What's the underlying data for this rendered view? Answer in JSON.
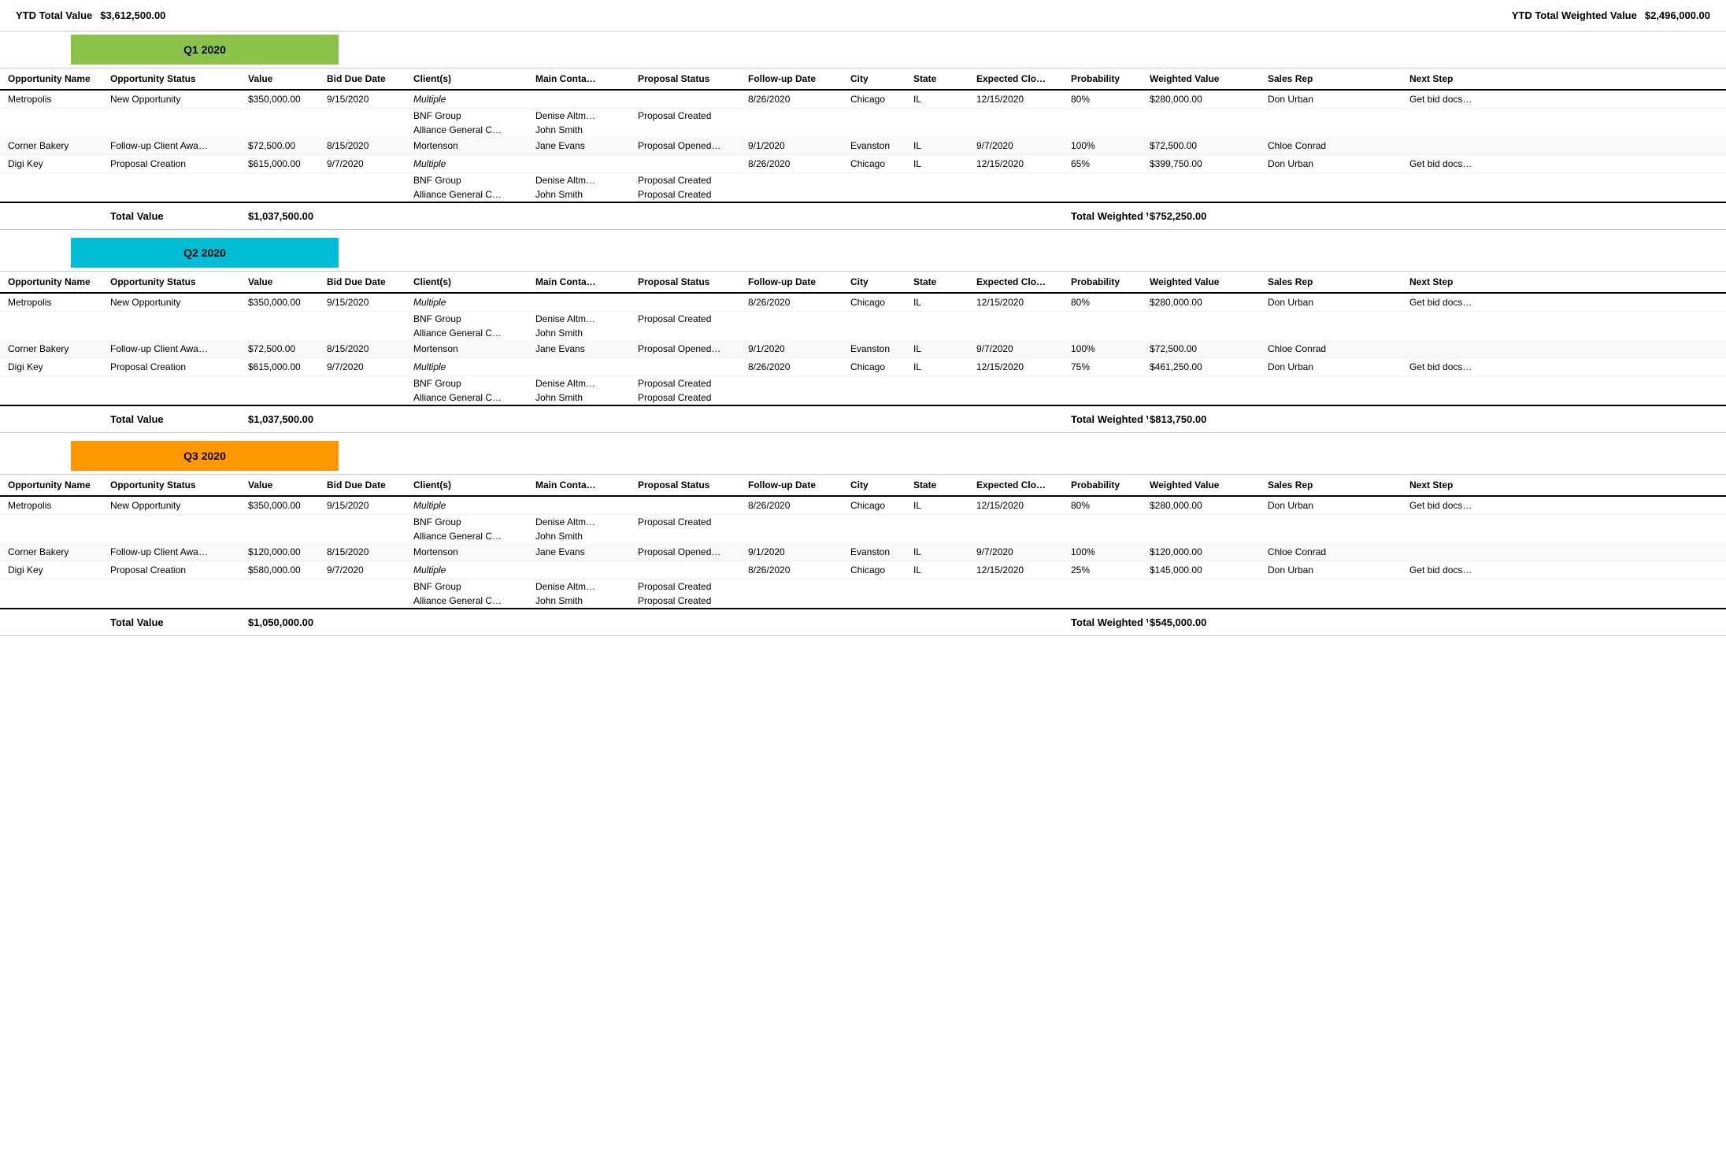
{
  "ytd": {
    "total_value_label": "YTD Total Value",
    "total_value": "$3,612,500.00",
    "total_weighted_label": "YTD Total Weighted Value",
    "total_weighted": "$2,496,000.00"
  },
  "columns": [
    "Opportunity Name",
    "Opportunity Status",
    "Value",
    "Bid Due Date",
    "Client(s)",
    "Main Conta…",
    "Proposal Status",
    "Follow-up Date",
    "City",
    "State",
    "Expected Clo…",
    "Probability",
    "Weighted Value",
    "Sales Rep",
    "Next Step"
  ],
  "quarters": [
    {
      "label": "Q1 2020",
      "class": "q1",
      "opportunities": [
        {
          "name": "Metropolis",
          "status": "New Opportunity",
          "value": "$350,000.00",
          "bid_due": "9/15/2020",
          "clients": [
            "Multiple",
            "BNF Group",
            "Alliance General C…"
          ],
          "contacts": [
            "",
            "Denise Altm…",
            "John Smith"
          ],
          "proposal_status": [
            "",
            "Proposal Created",
            ""
          ],
          "follow_up": "8/26/2020",
          "city": "Chicago",
          "state": "IL",
          "expected_close": "12/15/2020",
          "probability": "80%",
          "weighted": "$280,000.00",
          "sales_rep": "Don Urban",
          "next_step": "Get bid docs…"
        },
        {
          "name": "Corner Bakery",
          "status": "Follow-up Client Awa…",
          "value": "$72,500.00",
          "bid_due": "8/15/2020",
          "clients": [
            "Mortenson"
          ],
          "contacts": [
            "Jane Evans"
          ],
          "proposal_status": [
            "Proposal Opened…"
          ],
          "follow_up": "9/1/2020",
          "city": "Evanston",
          "state": "IL",
          "expected_close": "9/7/2020",
          "probability": "100%",
          "weighted": "$72,500.00",
          "sales_rep": "Chloe Conrad",
          "next_step": ""
        },
        {
          "name": "Digi Key",
          "status": "Proposal Creation",
          "value": "$615,000.00",
          "bid_due": "9/7/2020",
          "clients": [
            "Multiple",
            "BNF Group",
            "Alliance General C…"
          ],
          "contacts": [
            "",
            "Denise Altm…",
            "John Smith"
          ],
          "proposal_status": [
            "",
            "Proposal Created",
            "Proposal Created"
          ],
          "follow_up": "8/26/2020",
          "city": "Chicago",
          "state": "IL",
          "expected_close": "12/15/2020",
          "probability": "65%",
          "weighted": "$399,750.00",
          "sales_rep": "Don Urban",
          "next_step": "Get bid docs…"
        }
      ],
      "total_value_label": "Total Value",
      "total_value": "$1,037,500.00",
      "total_weighted_label": "Total Weighted Value",
      "total_weighted": "$752,250.00"
    },
    {
      "label": "Q2 2020",
      "class": "q2",
      "opportunities": [
        {
          "name": "Metropolis",
          "status": "New Opportunity",
          "value": "$350,000.00",
          "bid_due": "9/15/2020",
          "clients": [
            "Multiple",
            "BNF Group",
            "Alliance General C…"
          ],
          "contacts": [
            "",
            "Denise Altm…",
            "John Smith"
          ],
          "proposal_status": [
            "",
            "Proposal Created",
            ""
          ],
          "follow_up": "8/26/2020",
          "city": "Chicago",
          "state": "IL",
          "expected_close": "12/15/2020",
          "probability": "80%",
          "weighted": "$280,000.00",
          "sales_rep": "Don Urban",
          "next_step": "Get bid docs…"
        },
        {
          "name": "Corner Bakery",
          "status": "Follow-up Client Awa…",
          "value": "$72,500.00",
          "bid_due": "8/15/2020",
          "clients": [
            "Mortenson"
          ],
          "contacts": [
            "Jane Evans"
          ],
          "proposal_status": [
            "Proposal Opened…"
          ],
          "follow_up": "9/1/2020",
          "city": "Evanston",
          "state": "IL",
          "expected_close": "9/7/2020",
          "probability": "100%",
          "weighted": "$72,500.00",
          "sales_rep": "Chloe Conrad",
          "next_step": ""
        },
        {
          "name": "Digi Key",
          "status": "Proposal Creation",
          "value": "$615,000.00",
          "bid_due": "9/7/2020",
          "clients": [
            "Multiple",
            "BNF Group",
            "Alliance General C…"
          ],
          "contacts": [
            "",
            "Denise Altm…",
            "John Smith"
          ],
          "proposal_status": [
            "",
            "Proposal Created",
            "Proposal Created"
          ],
          "follow_up": "8/26/2020",
          "city": "Chicago",
          "state": "IL",
          "expected_close": "12/15/2020",
          "probability": "75%",
          "weighted": "$461,250.00",
          "sales_rep": "Don Urban",
          "next_step": "Get bid docs…"
        }
      ],
      "total_value_label": "Total Value",
      "total_value": "$1,037,500.00",
      "total_weighted_label": "Total Weighted Value",
      "total_weighted": "$813,750.00"
    },
    {
      "label": "Q3 2020",
      "class": "q3",
      "opportunities": [
        {
          "name": "Metropolis",
          "status": "New Opportunity",
          "value": "$350,000.00",
          "bid_due": "9/15/2020",
          "clients": [
            "Multiple",
            "BNF Group",
            "Alliance General C…"
          ],
          "contacts": [
            "",
            "Denise Altm…",
            "John Smith"
          ],
          "proposal_status": [
            "",
            "Proposal Created",
            ""
          ],
          "follow_up": "8/26/2020",
          "city": "Chicago",
          "state": "IL",
          "expected_close": "12/15/2020",
          "probability": "80%",
          "weighted": "$280,000.00",
          "sales_rep": "Don Urban",
          "next_step": "Get bid docs…"
        },
        {
          "name": "Corner Bakery",
          "status": "Follow-up Client Awa…",
          "value": "$120,000.00",
          "bid_due": "8/15/2020",
          "clients": [
            "Mortenson"
          ],
          "contacts": [
            "Jane Evans"
          ],
          "proposal_status": [
            "Proposal Opened…"
          ],
          "follow_up": "9/1/2020",
          "city": "Evanston",
          "state": "IL",
          "expected_close": "9/7/2020",
          "probability": "100%",
          "weighted": "$120,000.00",
          "sales_rep": "Chloe Conrad",
          "next_step": ""
        },
        {
          "name": "Digi Key",
          "status": "Proposal Creation",
          "value": "$580,000.00",
          "bid_due": "9/7/2020",
          "clients": [
            "Multiple",
            "BNF Group",
            "Alliance General C…"
          ],
          "contacts": [
            "",
            "Denise Altm…",
            "John Smith"
          ],
          "proposal_status": [
            "",
            "Proposal Created",
            "Proposal Created"
          ],
          "follow_up": "8/26/2020",
          "city": "Chicago",
          "state": "IL",
          "expected_close": "12/15/2020",
          "probability": "25%",
          "weighted": "$145,000.00",
          "sales_rep": "Don Urban",
          "next_step": "Get bid docs…"
        }
      ],
      "total_value_label": "Total Value",
      "total_value": "$1,050,000.00",
      "total_weighted_label": "Total Weighted Value",
      "total_weighted": "$545,000.00"
    }
  ]
}
